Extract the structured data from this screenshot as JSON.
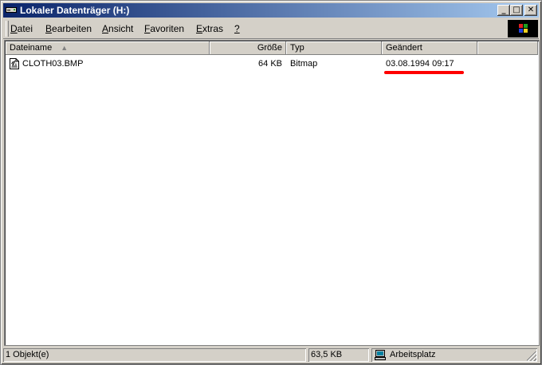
{
  "window": {
    "title": "Lokaler Datenträger (H:)"
  },
  "title_buttons": {
    "minimize": "_",
    "maximize": "□",
    "close": "✕"
  },
  "menu": [
    {
      "underline": "D",
      "rest": "atei"
    },
    {
      "underline": "B",
      "rest": "earbeiten"
    },
    {
      "underline": "A",
      "rest": "nsicht"
    },
    {
      "underline": "F",
      "rest": "avoriten"
    },
    {
      "underline": "E",
      "rest": "xtras"
    },
    {
      "underline": "?",
      "rest": ""
    }
  ],
  "columns": {
    "name": "Dateiname",
    "size": "Größe",
    "type": "Typ",
    "modified": "Geändert",
    "sort_indicator": "▲"
  },
  "files": [
    {
      "name": "CLOTH03.BMP",
      "size": "64 KB",
      "type": "Bitmap",
      "modified": "03.08.1994 09:17",
      "icon": "bitmap-file-icon"
    }
  ],
  "highlight_color": "#ff0000",
  "status": {
    "objects": "1 Objekt(e)",
    "size": "63,5 KB",
    "location": "Arbeitsplatz"
  }
}
